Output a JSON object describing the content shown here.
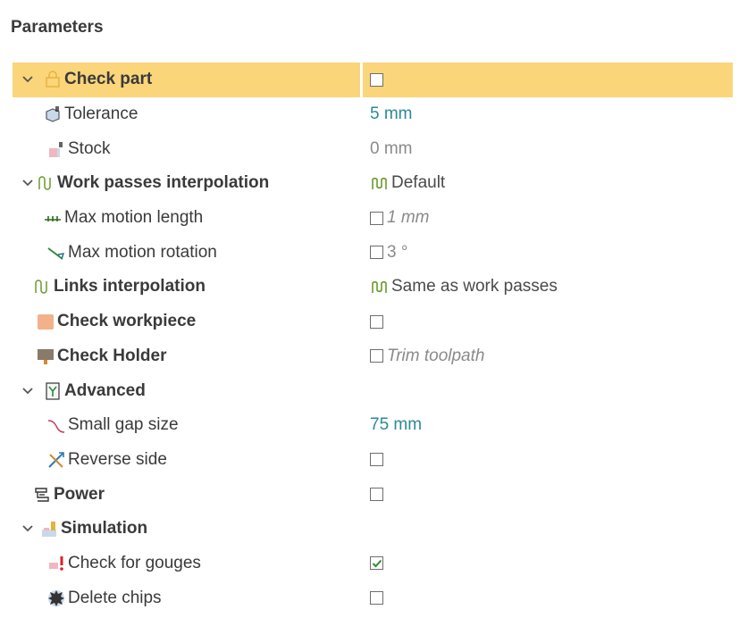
{
  "panel": {
    "title": "Parameters"
  },
  "rows": [
    {
      "label": "Check part",
      "value": ""
    },
    {
      "label": "Tolerance",
      "value": "5 mm"
    },
    {
      "label": "Stock",
      "value": "0 mm"
    },
    {
      "label": "Work passes interpolation",
      "value": "Default"
    },
    {
      "label": "Max motion length",
      "value": "1 mm"
    },
    {
      "label": "Max motion rotation",
      "value": "3 °"
    },
    {
      "label": "Links interpolation",
      "value": "Same as work passes"
    },
    {
      "label": "Check workpiece",
      "value": ""
    },
    {
      "label": "Check Holder",
      "value": "Trim toolpath"
    },
    {
      "label": "Advanced",
      "value": ""
    },
    {
      "label": "Small gap size",
      "value": "75 mm"
    },
    {
      "label": "Reverse side",
      "value": ""
    },
    {
      "label": "Power",
      "value": ""
    },
    {
      "label": "Simulation",
      "value": ""
    },
    {
      "label": "Check for gouges",
      "value": ""
    },
    {
      "label": "Delete chips",
      "value": ""
    }
  ],
  "states": {
    "check_for_gouges_checked": true
  },
  "colors": {
    "selected_row": "#fbd57a",
    "value_accent": "#2a8a9a",
    "checkmark": "#2e8b2e"
  },
  "icons": [
    "lock-icon",
    "tolerance-cube-icon",
    "stock-icon",
    "interpolation-icon",
    "max-length-icon",
    "rotation-icon",
    "links-interpolation-icon",
    "workpiece-icon",
    "holder-icon",
    "advanced-icon",
    "gap-curve-icon",
    "reverse-side-icon",
    "power-icon",
    "simulation-icon",
    "gouge-icon",
    "chip-icon"
  ]
}
